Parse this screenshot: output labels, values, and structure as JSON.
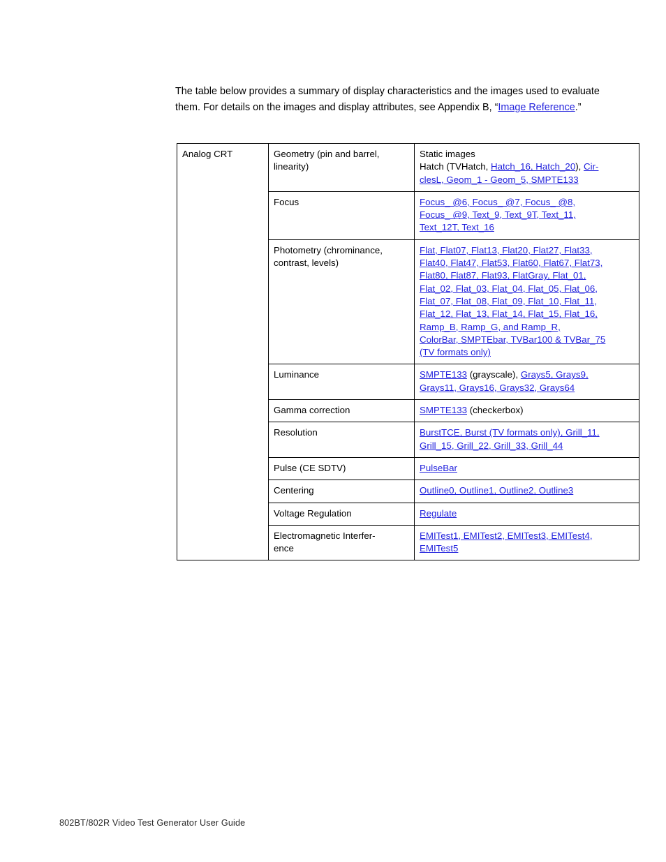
{
  "page": {
    "intro": {
      "text_before_link": "The table below provides a summary of display characteristics and the images used to evaluate them. For details on the images and display attributes, see Appendix B, “",
      "link_text": "Image Reference",
      "text_after_link": ".”"
    },
    "footer": {
      "text": "802BT/802R Video Test Generator User Guide"
    }
  },
  "colors": {
    "link_blue": "#2222DD",
    "body_text": "#000000",
    "table_border": "#000000",
    "page_background": "#ffffff"
  },
  "table": {
    "category_label": "Analog CRT",
    "rows": [
      {
        "attribute": "Geometry (pin and barrel, linearity)",
        "images_segments": [
          {
            "text": "Static images\nHatch (TVHatch, ",
            "style": "plain"
          },
          {
            "text": "Hatch_16, Hatch_20",
            "style": "link"
          },
          {
            "text": "), ",
            "style": "plain"
          },
          {
            "text": "Cir-\nclesL, Geom_1 - Geom_5, SMPTE133",
            "style": "link"
          }
        ]
      },
      {
        "attribute": "Focus",
        "images_segments": [
          {
            "text": "Focus_ @6, Focus_ @7, Focus_ @8,\nFocus_ @9, Text_9, Text_9T, Text_11,\nText_12T, Text_16",
            "style": "link"
          }
        ]
      },
      {
        "attribute": "Photometry (chrominance, contrast, levels)",
        "images_segments": [
          {
            "text": "Flat, Flat07, Flat13, Flat20, Flat27, Flat33,\nFlat40, Flat47, Flat53, Flat60, Flat67, Flat73,\nFlat80, Flat87, Flat93, FlatGray, Flat_01,\nFlat_02, Flat_03, Flat_04, Flat_05, Flat_06,\nFlat_07, Flat_08, Flat_09, Flat_10, Flat_11,\nFlat_12, Flat_13, Flat_14, Flat_15, Flat_16,\nRamp_B, Ramp_G, and Ramp_R,\nColorBar, SMPTEbar, TVBar100 & TVBar_75\n(TV formats only)",
            "style": "link"
          }
        ]
      },
      {
        "attribute": "Luminance",
        "images_segments": [
          {
            "text": "SMPTE133",
            "style": "link"
          },
          {
            "text": " (grayscale), ",
            "style": "plain"
          },
          {
            "text": "Grays5, Grays9,\nGrays11, Grays16, Grays32, Grays64",
            "style": "link"
          }
        ]
      },
      {
        "attribute": "Gamma correction",
        "images_segments": [
          {
            "text": "SMPTE133",
            "style": "link"
          },
          {
            "text": " (checkerbox)",
            "style": "plain"
          }
        ]
      },
      {
        "attribute": "Resolution",
        "images_segments": [
          {
            "text": "BurstTCE, Burst (TV formats only), Grill_11,\nGrill_15, Grill_22, Grill_33, Grill_44",
            "style": "link"
          }
        ]
      },
      {
        "attribute": "Pulse (CE SDTV)",
        "images_segments": [
          {
            "text": "PulseBar",
            "style": "link"
          }
        ]
      },
      {
        "attribute": "Centering",
        "images_segments": [
          {
            "text": "Outline0, Outline1, Outline2, Outline3",
            "style": "link"
          }
        ]
      },
      {
        "attribute": "Voltage Regulation",
        "images_segments": [
          {
            "text": "Regulate",
            "style": "link"
          }
        ]
      },
      {
        "attribute": "Electromagnetic Interfer-ence",
        "attribute_display": "Electromagnetic Interfer-\nence",
        "images_segments": [
          {
            "text": "EMITest1, EMITest2, EMITest3, EMITest4,\nEMITest5",
            "style": "link"
          }
        ]
      }
    ]
  }
}
